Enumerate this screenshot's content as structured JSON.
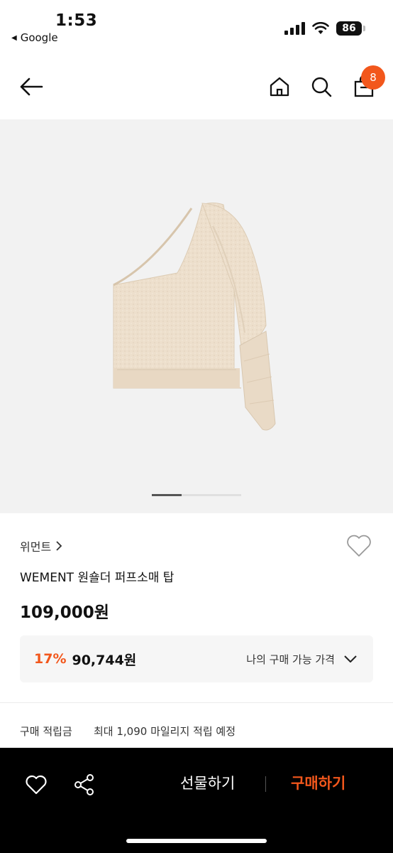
{
  "status_bar": {
    "time": "1:53",
    "back_app": "Google",
    "battery": "86"
  },
  "header": {
    "cart_count": "8",
    "icons": [
      "back-arrow-icon",
      "home-icon",
      "search-icon",
      "shopping-bag-icon"
    ]
  },
  "product": {
    "brand": "위먼트",
    "name": "WEMENT 원숄더 퍼프소매 탑",
    "price": "109,000원",
    "image_pages": 2,
    "image_current": 1,
    "discount": {
      "percent": "17%",
      "price": "90,744원",
      "my_price_label": "나의 구매 가능 가격"
    },
    "points": {
      "label": "구매 적립금",
      "value": "최대 1,090 마일리지 적립 예정"
    }
  },
  "bottom_bar": {
    "gift_label": "선물하기",
    "buy_label": "구매하기"
  },
  "colors": {
    "accent": "#f2571c",
    "image_bg": "#f2f2f2",
    "sweater": "#eddfcc"
  }
}
